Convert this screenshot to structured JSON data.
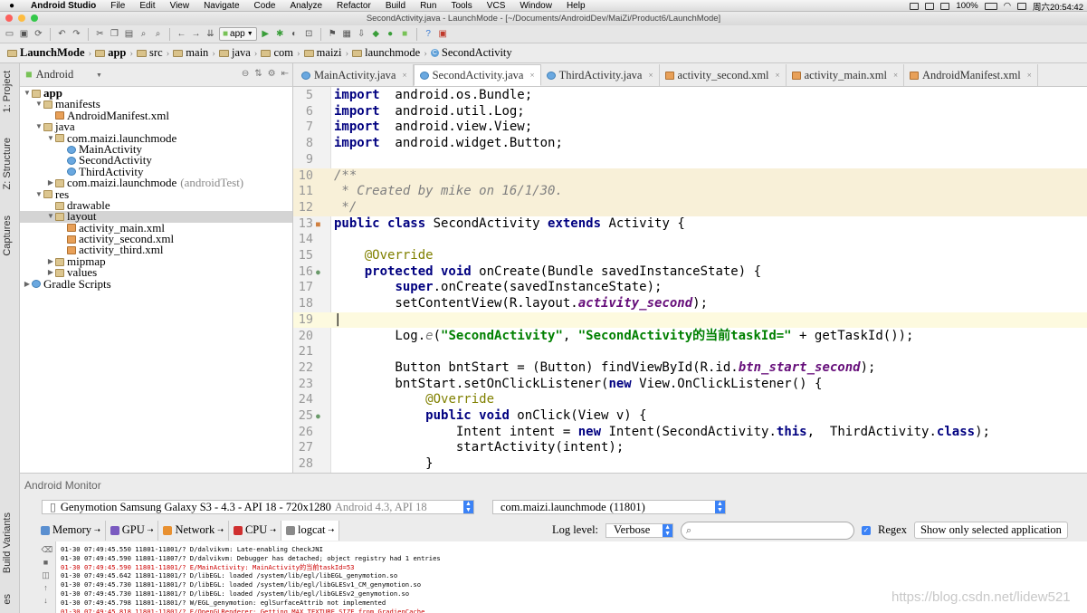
{
  "menubar": {
    "app": "Android Studio",
    "items": [
      "File",
      "Edit",
      "View",
      "Navigate",
      "Code",
      "Analyze",
      "Refactor",
      "Build",
      "Run",
      "Tools",
      "VCS",
      "Window",
      "Help"
    ],
    "battery": "100%",
    "clock": "周六20:54:42"
  },
  "titlebar": {
    "title": "SecondActivity.java - LaunchMode - [~/Documents/AndroidDev/MaiZi/Product6/LaunchMode]"
  },
  "toolbar": {
    "app_config": "app"
  },
  "breadcrumb": [
    "LaunchMode",
    "app",
    "src",
    "main",
    "java",
    "com",
    "maizi",
    "launchmode",
    "SecondActivity"
  ],
  "sidebar_tabs": {
    "project": "1: Project",
    "structure": "Z: Structure",
    "captures": "Captures",
    "variants": "Build Variants",
    "favorites": "es"
  },
  "project": {
    "view": "Android",
    "tree": [
      {
        "label": "app",
        "level": 0,
        "arrow": "▼",
        "icon": "fld",
        "bold": true
      },
      {
        "label": "manifests",
        "level": 1,
        "arrow": "▼",
        "icon": "fld"
      },
      {
        "label": "AndroidManifest.xml",
        "level": 2,
        "arrow": "",
        "icon": "xml"
      },
      {
        "label": "java",
        "level": 1,
        "arrow": "▼",
        "icon": "fld"
      },
      {
        "label": "com.maizi.launchmode",
        "level": 2,
        "arrow": "▼",
        "icon": "fld"
      },
      {
        "label": "MainActivity",
        "level": 3,
        "arrow": "",
        "icon": "cls"
      },
      {
        "label": "SecondActivity",
        "level": 3,
        "arrow": "",
        "icon": "cls"
      },
      {
        "label": "ThirdActivity",
        "level": 3,
        "arrow": "",
        "icon": "cls"
      },
      {
        "label": "com.maizi.launchmode",
        "level": 2,
        "arrow": "▶",
        "icon": "fld",
        "suffix": "(androidTest)"
      },
      {
        "label": "res",
        "level": 1,
        "arrow": "▼",
        "icon": "fld"
      },
      {
        "label": "drawable",
        "level": 2,
        "arrow": "",
        "icon": "fld"
      },
      {
        "label": "layout",
        "level": 2,
        "arrow": "▼",
        "icon": "fld",
        "selected": true
      },
      {
        "label": "activity_main.xml",
        "level": 3,
        "arrow": "",
        "icon": "xml"
      },
      {
        "label": "activity_second.xml",
        "level": 3,
        "arrow": "",
        "icon": "xml"
      },
      {
        "label": "activity_third.xml",
        "level": 3,
        "arrow": "",
        "icon": "xml"
      },
      {
        "label": "mipmap",
        "level": 2,
        "arrow": "▶",
        "icon": "fld"
      },
      {
        "label": "values",
        "level": 2,
        "arrow": "▶",
        "icon": "fld"
      },
      {
        "label": "Gradle Scripts",
        "level": 0,
        "arrow": "▶",
        "icon": "cls"
      }
    ]
  },
  "editor_tabs": [
    {
      "label": "MainActivity.java",
      "icon": "cls",
      "active": false
    },
    {
      "label": "SecondActivity.java",
      "icon": "cls",
      "active": true
    },
    {
      "label": "ThirdActivity.java",
      "icon": "cls",
      "active": false
    },
    {
      "label": "activity_second.xml",
      "icon": "xml",
      "active": false
    },
    {
      "label": "activity_main.xml",
      "icon": "xml",
      "active": false
    },
    {
      "label": "AndroidManifest.xml",
      "icon": "xml",
      "active": false
    }
  ],
  "code_lines": [
    {
      "n": "5",
      "hl": "",
      "mark": "",
      "parts": [
        [
          "kw",
          "import"
        ],
        [
          "",
          "  android.os.Bundle;"
        ]
      ]
    },
    {
      "n": "6",
      "hl": "",
      "mark": "",
      "parts": [
        [
          "kw",
          "import"
        ],
        [
          "",
          "  android.util.Log;"
        ]
      ]
    },
    {
      "n": "7",
      "hl": "",
      "mark": "",
      "parts": [
        [
          "kw",
          "import"
        ],
        [
          "",
          "  android.view.View;"
        ]
      ]
    },
    {
      "n": "8",
      "hl": "",
      "mark": "",
      "parts": [
        [
          "kw",
          "import"
        ],
        [
          "",
          "  android.widget.Button;"
        ]
      ]
    },
    {
      "n": "9",
      "hl": "",
      "mark": "",
      "parts": []
    },
    {
      "n": "10",
      "hl": "doc",
      "mark": "",
      "parts": [
        [
          "cmt",
          "/**"
        ]
      ]
    },
    {
      "n": "11",
      "hl": "doc",
      "mark": "",
      "parts": [
        [
          "cmt",
          " * Created by mike on 16/1/30."
        ]
      ]
    },
    {
      "n": "12",
      "hl": "doc",
      "mark": "",
      "parts": [
        [
          "cmt",
          " */"
        ]
      ]
    },
    {
      "n": "13",
      "hl": "",
      "mark": "class",
      "parts": [
        [
          "kw",
          "public class"
        ],
        [
          "",
          " SecondActivity "
        ],
        [
          "kw",
          "extends"
        ],
        [
          "",
          " Activity {"
        ]
      ]
    },
    {
      "n": "14",
      "hl": "",
      "mark": "",
      "parts": []
    },
    {
      "n": "15",
      "hl": "",
      "mark": "",
      "parts": [
        [
          "",
          "    "
        ],
        [
          "ann",
          "@Override"
        ]
      ]
    },
    {
      "n": "16",
      "hl": "",
      "mark": "override",
      "parts": [
        [
          "",
          "    "
        ],
        [
          "kw",
          "protected void"
        ],
        [
          "",
          " onCreate(Bundle savedInstanceState) {"
        ]
      ]
    },
    {
      "n": "17",
      "hl": "",
      "mark": "",
      "parts": [
        [
          "",
          "        "
        ],
        [
          "kw",
          "super"
        ],
        [
          "",
          ".onCreate(savedInstanceState);"
        ]
      ]
    },
    {
      "n": "18",
      "hl": "",
      "mark": "",
      "parts": [
        [
          "",
          "        setContentView(R.layout."
        ],
        [
          "fld-i",
          "activity_second"
        ],
        [
          "",
          ");"
        ]
      ]
    },
    {
      "n": "19",
      "hl": "cur",
      "mark": "",
      "parts": [
        [
          "",
          "|"
        ]
      ]
    },
    {
      "n": "20",
      "hl": "",
      "mark": "",
      "parts": [
        [
          "",
          "        Log."
        ],
        [
          "cmt",
          "e"
        ],
        [
          "",
          "("
        ],
        [
          "str",
          "\"SecondActivity\""
        ],
        [
          "",
          ", "
        ],
        [
          "str",
          "\"SecondActivity的当前taskId=\""
        ],
        [
          "",
          " + getTaskId());"
        ]
      ]
    },
    {
      "n": "21",
      "hl": "",
      "mark": "",
      "parts": []
    },
    {
      "n": "22",
      "hl": "",
      "mark": "",
      "parts": [
        [
          "",
          "        Button bntStart = (Button) findViewById(R.id."
        ],
        [
          "fld-i",
          "btn_start_second"
        ],
        [
          "",
          ");"
        ]
      ]
    },
    {
      "n": "23",
      "hl": "",
      "mark": "",
      "parts": [
        [
          "",
          "        bntStart.setOnClickListener("
        ],
        [
          "kw",
          "new"
        ],
        [
          "",
          " View.OnClickListener() {"
        ]
      ]
    },
    {
      "n": "24",
      "hl": "",
      "mark": "",
      "parts": [
        [
          "",
          "            "
        ],
        [
          "ann",
          "@Override"
        ]
      ]
    },
    {
      "n": "25",
      "hl": "",
      "mark": "override",
      "parts": [
        [
          "",
          "            "
        ],
        [
          "kw",
          "public void"
        ],
        [
          "",
          " onClick(View v) {"
        ]
      ]
    },
    {
      "n": "26",
      "hl": "",
      "mark": "",
      "parts": [
        [
          "",
          "                Intent intent = "
        ],
        [
          "kw",
          "new"
        ],
        [
          "",
          " Intent(SecondActivity."
        ],
        [
          "kw",
          "this"
        ],
        [
          "",
          ",  ThirdActivity."
        ],
        [
          "kw",
          "class"
        ],
        [
          "",
          ");"
        ]
      ]
    },
    {
      "n": "27",
      "hl": "",
      "mark": "",
      "parts": [
        [
          "",
          "                startActivity(intent);"
        ]
      ]
    },
    {
      "n": "28",
      "hl": "",
      "mark": "",
      "parts": [
        [
          "",
          "            }"
        ]
      ]
    }
  ],
  "monitor": {
    "title": "Android Monitor",
    "device": "Genymotion Samsung Galaxy S3 - 4.3 - API 18 - 720x1280",
    "device_api": "Android 4.3, API 18",
    "process": "com.maizi.launchmode",
    "process_pid": "(11801)",
    "tabs": [
      "Memory",
      "GPU",
      "Network",
      "CPU",
      "logcat"
    ],
    "log_level_label": "Log level:",
    "log_level": "Verbose",
    "regex_label": "Regex",
    "show_only": "Show only selected application",
    "log_lines": [
      {
        "t": "01-30 07:49:45.550 11801-11801/? D/dalvikvm: Late-enabling CheckJNI",
        "err": false
      },
      {
        "t": "01-30 07:49:45.590 11801-11807/? D/dalvikvm: Debugger has detached; object registry had 1 entries",
        "err": false
      },
      {
        "t": "01-30 07:49:45.590 11801-11801/? E/MainActivity: MainActivity的当前taskId=53",
        "err": true
      },
      {
        "t": "01-30 07:49:45.642 11801-11801/? D/libEGL: loaded /system/lib/egl/libEGL_genymotion.so",
        "err": false
      },
      {
        "t": "01-30 07:49:45.730 11801-11801/? D/libEGL: loaded /system/lib/egl/libGLESv1_CM_genymotion.so",
        "err": false
      },
      {
        "t": "01-30 07:49:45.730 11801-11801/? D/libEGL: loaded /system/lib/egl/libGLESv2_genymotion.so",
        "err": false
      },
      {
        "t": "01-30 07:49:45.798 11801-11801/? W/EGL_genymotion: eglSurfaceAttrib not implemented",
        "err": false
      },
      {
        "t": "01-30 07:49:45.818 11801-11801/? E/OpenGLRenderer: Getting MAX_TEXTURE_SIZE from GradienCache",
        "err": true
      }
    ]
  },
  "watermark": "https://blog.csdn.net/lidew521"
}
